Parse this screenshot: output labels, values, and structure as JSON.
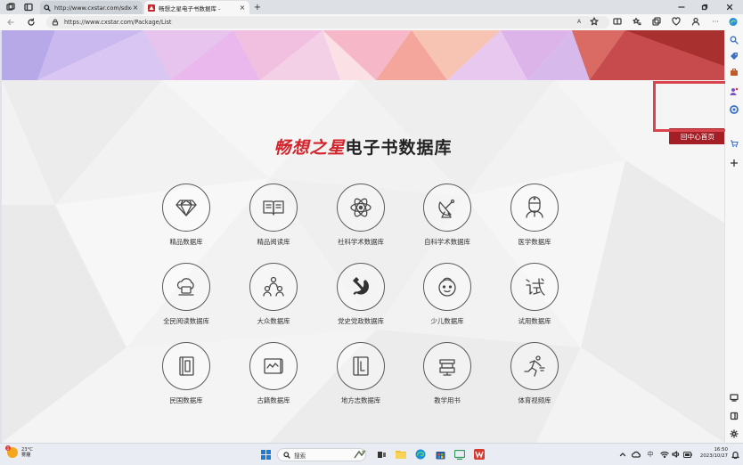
{
  "browser": {
    "tabs": [
      {
        "title": "http://www.cxstar.com/sdxd.htm",
        "active": false
      },
      {
        "title": "畅想之星电子书数据库 -",
        "active": true
      }
    ],
    "new_tab_label": "+",
    "url": "https://www.cxstar.com/Package/List",
    "read_aloud_label": "A"
  },
  "page": {
    "title_accent": "畅想之星",
    "title_rest": "电子书数据库",
    "home_button": "回中心首页",
    "databases": [
      {
        "label": "精品数据库",
        "icon": "diamond-icon"
      },
      {
        "label": "精品阅读库",
        "icon": "open-book-icon"
      },
      {
        "label": "社科学术数据库",
        "icon": "atom-icon"
      },
      {
        "label": "自科学术数据库",
        "icon": "satellite-dish-icon"
      },
      {
        "label": "医学数据库",
        "icon": "doctor-icon"
      },
      {
        "label": "全民阅读数据库",
        "icon": "cloud-laptop-icon"
      },
      {
        "label": "大众数据库",
        "icon": "people-network-icon"
      },
      {
        "label": "党史党政数据库",
        "icon": "hammer-sickle-icon"
      },
      {
        "label": "少儿数据库",
        "icon": "child-face-icon"
      },
      {
        "label": "试用数据库",
        "icon": "trial-character-icon"
      },
      {
        "label": "民国数据库",
        "icon": "old-book-icon"
      },
      {
        "label": "古籍数据库",
        "icon": "scroll-icon"
      },
      {
        "label": "地方志数据库",
        "icon": "local-chronicle-book-icon"
      },
      {
        "label": "教学用书",
        "icon": "stacked-books-icon"
      },
      {
        "label": "体育视频库",
        "icon": "runner-icon"
      }
    ]
  },
  "taskbar": {
    "weather_temp": "23°C",
    "weather_desc": "雾霾",
    "weather_badge": "1",
    "search_placeholder": "搜索",
    "ime_label": "中",
    "time": "16:50",
    "date": "2023/10/27"
  },
  "colors": {
    "accent_red": "#d3232b",
    "button_red": "#a41e25",
    "highlight_red": "#d9434b"
  }
}
